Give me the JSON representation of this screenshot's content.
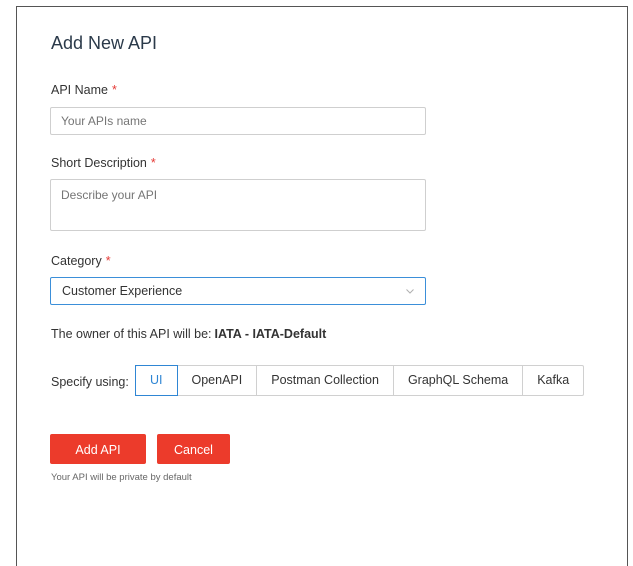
{
  "form": {
    "title": "Add New API",
    "required_marker": "*",
    "api_name": {
      "label": "API Name",
      "placeholder": "Your APIs name",
      "value": ""
    },
    "short_description": {
      "label": "Short Description",
      "placeholder": "Describe your API",
      "value": ""
    },
    "category": {
      "label": "Category",
      "selected": "Customer Experience"
    },
    "owner": {
      "prefix": "The owner of this API will be:",
      "value": "IATA - IATA-Default"
    },
    "specify": {
      "label": "Specify using:",
      "options": [
        "UI",
        "OpenAPI",
        "Postman Collection",
        "GraphQL Schema",
        "Kafka"
      ],
      "active_index": 0
    },
    "buttons": {
      "add_label": "Add API",
      "cancel_label": "Cancel"
    },
    "note": "Your API will be private by default"
  },
  "colors": {
    "primary_button": "#ec3b2b",
    "accent_blue": "#2f86d4",
    "required": "#e53935"
  },
  "icons": {
    "select_chevron": "chevron-down-icon"
  }
}
